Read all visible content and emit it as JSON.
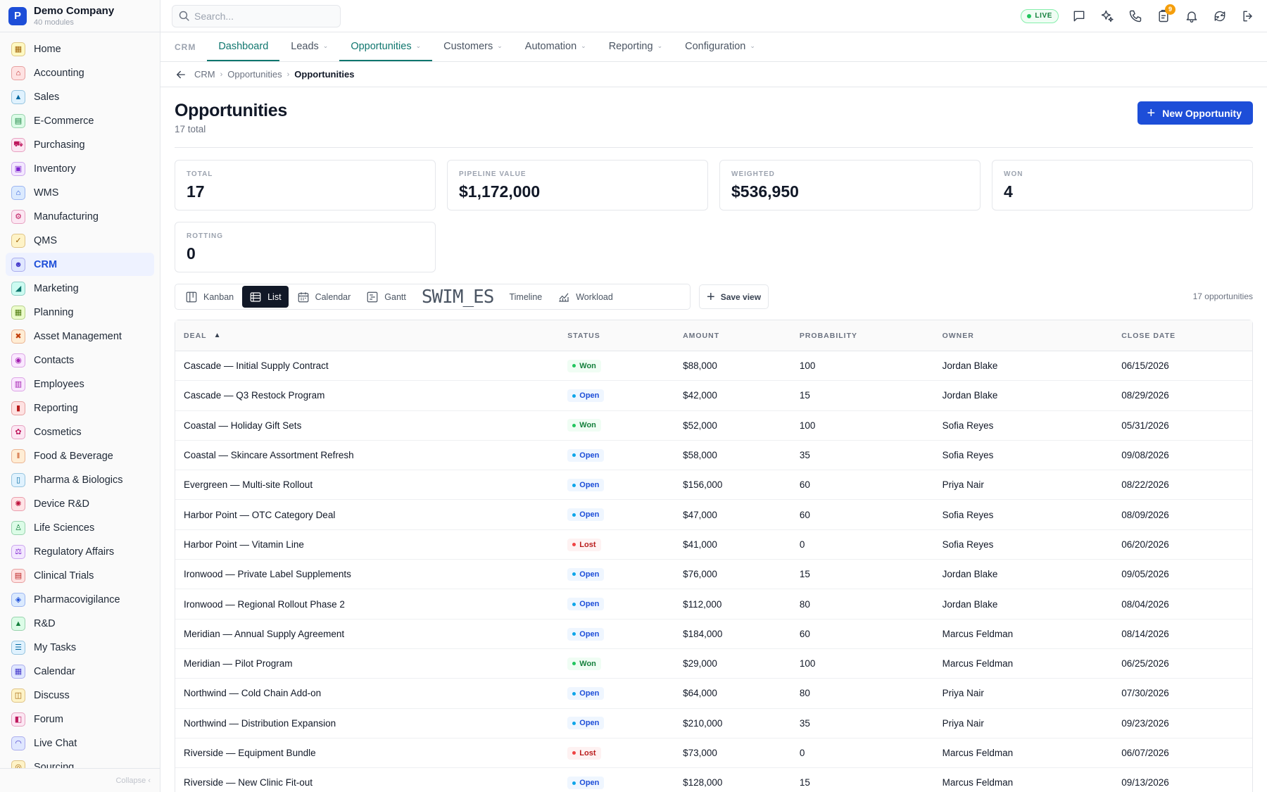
{
  "brand": {
    "logo_letter": "P",
    "name": "Demo Company",
    "subtitle": "40 modules"
  },
  "sidebar": {
    "items": [
      {
        "label": "Home",
        "icon": "grid-icon",
        "glyph": "▦",
        "color": "#a16207",
        "bg": "#fef9c3"
      },
      {
        "label": "Accounting",
        "icon": "bank-icon",
        "glyph": "⌂",
        "color": "#b91c1c",
        "bg": "#fee2e2"
      },
      {
        "label": "Sales",
        "icon": "flask-icon",
        "glyph": "▲",
        "color": "#0369a1",
        "bg": "#e0f2fe"
      },
      {
        "label": "E-Commerce",
        "icon": "store-icon",
        "glyph": "▤",
        "color": "#15803d",
        "bg": "#dcfce7"
      },
      {
        "label": "Purchasing",
        "icon": "cart-icon",
        "glyph": "⛟",
        "color": "#be185d",
        "bg": "#fce7f3"
      },
      {
        "label": "Inventory",
        "icon": "archive-icon",
        "glyph": "▣",
        "color": "#7e22ce",
        "bg": "#f3e8ff"
      },
      {
        "label": "WMS",
        "icon": "warehouse-icon",
        "glyph": "⌂",
        "color": "#1d4ed8",
        "bg": "#dbeafe"
      },
      {
        "label": "Manufacturing",
        "icon": "factory-icon",
        "glyph": "⚙",
        "color": "#be185d",
        "bg": "#fce7f3"
      },
      {
        "label": "QMS",
        "icon": "check-badge-icon",
        "glyph": "✓",
        "color": "#a16207",
        "bg": "#fef3c7"
      },
      {
        "label": "CRM",
        "icon": "users-icon",
        "glyph": "☻",
        "color": "#4338ca",
        "bg": "#e0e7ff"
      },
      {
        "label": "Marketing",
        "icon": "megaphone-icon",
        "glyph": "◢",
        "color": "#0f766e",
        "bg": "#ccfbf1"
      },
      {
        "label": "Planning",
        "icon": "calendar-icon",
        "glyph": "▦",
        "color": "#4d7c0f",
        "bg": "#ecfccb"
      },
      {
        "label": "Asset Management",
        "icon": "tools-icon",
        "glyph": "✖",
        "color": "#c2410c",
        "bg": "#ffedd5"
      },
      {
        "label": "Contacts",
        "icon": "contact-icon",
        "glyph": "◉",
        "color": "#a21caf",
        "bg": "#fae8ff"
      },
      {
        "label": "Employees",
        "icon": "briefcase-icon",
        "glyph": "▥",
        "color": "#a21caf",
        "bg": "#fae8ff"
      },
      {
        "label": "Reporting",
        "icon": "bar-chart-icon",
        "glyph": "▮",
        "color": "#b91c1c",
        "bg": "#fee2e2"
      },
      {
        "label": "Cosmetics",
        "icon": "lotus-icon",
        "glyph": "✿",
        "color": "#be185d",
        "bg": "#fce7f3"
      },
      {
        "label": "Food & Beverage",
        "icon": "utensils-icon",
        "glyph": "‖",
        "color": "#c2410c",
        "bg": "#ffedd5"
      },
      {
        "label": "Pharma & Biologics",
        "icon": "pill-bottle-icon",
        "glyph": "▯",
        "color": "#0369a1",
        "bg": "#e0f2fe"
      },
      {
        "label": "Device R&D",
        "icon": "chip-icon",
        "glyph": "✺",
        "color": "#be123c",
        "bg": "#ffe4e6"
      },
      {
        "label": "Life Sciences",
        "icon": "microscope-icon",
        "glyph": "♙",
        "color": "#15803d",
        "bg": "#dcfce7"
      },
      {
        "label": "Regulatory Affairs",
        "icon": "gavel-icon",
        "glyph": "⚖",
        "color": "#7e22ce",
        "bg": "#f3e8ff"
      },
      {
        "label": "Clinical Trials",
        "icon": "clipboard-icon",
        "glyph": "▤",
        "color": "#b91c1c",
        "bg": "#fee2e2"
      },
      {
        "label": "Pharmacovigilance",
        "icon": "shield-icon",
        "glyph": "◈",
        "color": "#1d4ed8",
        "bg": "#dbeafe"
      },
      {
        "label": "R&D",
        "icon": "beaker-icon",
        "glyph": "▲",
        "color": "#15803d",
        "bg": "#dcfce7"
      },
      {
        "label": "My Tasks",
        "icon": "checklist-icon",
        "glyph": "☰",
        "color": "#0369a1",
        "bg": "#e0f2fe"
      },
      {
        "label": "Calendar",
        "icon": "calendar-icon",
        "glyph": "▦",
        "color": "#4338ca",
        "bg": "#e0e7ff"
      },
      {
        "label": "Discuss",
        "icon": "chat-icon",
        "glyph": "◫",
        "color": "#a16207",
        "bg": "#fef3c7"
      },
      {
        "label": "Forum",
        "icon": "forum-icon",
        "glyph": "◧",
        "color": "#be185d",
        "bg": "#fce7f3"
      },
      {
        "label": "Live Chat",
        "icon": "headset-icon",
        "glyph": "◠",
        "color": "#4338ca",
        "bg": "#e0e7ff"
      },
      {
        "label": "Sourcing",
        "icon": "globe-icon",
        "glyph": "◎",
        "color": "#a16207",
        "bg": "#fef3c7"
      }
    ],
    "active_index": 9,
    "collapse_label": "Collapse ‹"
  },
  "topbar": {
    "search_placeholder": "Search...",
    "live_label": "LIVE",
    "notification_count": "9"
  },
  "tabs": {
    "module": "CRM",
    "items": [
      {
        "label": "Dashboard",
        "active": true,
        "dropdown": false
      },
      {
        "label": "Leads",
        "active": false,
        "dropdown": true
      },
      {
        "label": "Opportunities",
        "active": true,
        "dropdown": true
      },
      {
        "label": "Customers",
        "active": false,
        "dropdown": true
      },
      {
        "label": "Automation",
        "active": false,
        "dropdown": true
      },
      {
        "label": "Reporting",
        "active": false,
        "dropdown": true
      },
      {
        "label": "Configuration",
        "active": false,
        "dropdown": true
      }
    ]
  },
  "breadcrumb": [
    "CRM",
    "Opportunities",
    "Opportunities"
  ],
  "page": {
    "title": "Opportunities",
    "subtitle": "17 total",
    "new_button": "New Opportunity"
  },
  "kpis": [
    {
      "label": "TOTAL",
      "value": "17"
    },
    {
      "label": "PIPELINE VALUE",
      "value": "$1,172,000"
    },
    {
      "label": "WEIGHTED",
      "value": "$536,950"
    },
    {
      "label": "WON",
      "value": "4"
    },
    {
      "label": "ROTTING",
      "value": "0"
    }
  ],
  "views": {
    "items": [
      "Kanban",
      "List",
      "Calendar",
      "Gantt",
      "SWIM_ES",
      "Timeline",
      "Workload"
    ],
    "active": "List",
    "save_label": "Save view",
    "count_label": "17 opportunities"
  },
  "table": {
    "columns": [
      "DEAL",
      "STATUS",
      "AMOUNT",
      "PROBABILITY",
      "OWNER",
      "CLOSE DATE"
    ],
    "rows": [
      {
        "deal": "Cascade — Initial Supply Contract",
        "status": "Won",
        "amount": "$88,000",
        "probability": "100",
        "owner": "Jordan Blake",
        "close": "06/15/2026"
      },
      {
        "deal": "Cascade — Q3 Restock Program",
        "status": "Open",
        "amount": "$42,000",
        "probability": "15",
        "owner": "Jordan Blake",
        "close": "08/29/2026"
      },
      {
        "deal": "Coastal — Holiday Gift Sets",
        "status": "Won",
        "amount": "$52,000",
        "probability": "100",
        "owner": "Sofia Reyes",
        "close": "05/31/2026"
      },
      {
        "deal": "Coastal — Skincare Assortment Refresh",
        "status": "Open",
        "amount": "$58,000",
        "probability": "35",
        "owner": "Sofia Reyes",
        "close": "09/08/2026"
      },
      {
        "deal": "Evergreen — Multi-site Rollout",
        "status": "Open",
        "amount": "$156,000",
        "probability": "60",
        "owner": "Priya Nair",
        "close": "08/22/2026"
      },
      {
        "deal": "Harbor Point — OTC Category Deal",
        "status": "Open",
        "amount": "$47,000",
        "probability": "60",
        "owner": "Sofia Reyes",
        "close": "08/09/2026"
      },
      {
        "deal": "Harbor Point — Vitamin Line",
        "status": "Lost",
        "amount": "$41,000",
        "probability": "0",
        "owner": "Sofia Reyes",
        "close": "06/20/2026"
      },
      {
        "deal": "Ironwood — Private Label Supplements",
        "status": "Open",
        "amount": "$76,000",
        "probability": "15",
        "owner": "Jordan Blake",
        "close": "09/05/2026"
      },
      {
        "deal": "Ironwood — Regional Rollout Phase 2",
        "status": "Open",
        "amount": "$112,000",
        "probability": "80",
        "owner": "Jordan Blake",
        "close": "08/04/2026"
      },
      {
        "deal": "Meridian — Annual Supply Agreement",
        "status": "Open",
        "amount": "$184,000",
        "probability": "60",
        "owner": "Marcus Feldman",
        "close": "08/14/2026"
      },
      {
        "deal": "Meridian — Pilot Program",
        "status": "Won",
        "amount": "$29,000",
        "probability": "100",
        "owner": "Marcus Feldman",
        "close": "06/25/2026"
      },
      {
        "deal": "Northwind — Cold Chain Add-on",
        "status": "Open",
        "amount": "$64,000",
        "probability": "80",
        "owner": "Priya Nair",
        "close": "07/30/2026"
      },
      {
        "deal": "Northwind — Distribution Expansion",
        "status": "Open",
        "amount": "$210,000",
        "probability": "35",
        "owner": "Priya Nair",
        "close": "09/23/2026"
      },
      {
        "deal": "Riverside — Equipment Bundle",
        "status": "Lost",
        "amount": "$73,000",
        "probability": "0",
        "owner": "Marcus Feldman",
        "close": "06/07/2026"
      },
      {
        "deal": "Riverside — New Clinic Fit-out",
        "status": "Open",
        "amount": "$128,000",
        "probability": "15",
        "owner": "Marcus Feldman",
        "close": "09/13/2026"
      }
    ]
  },
  "colors": {
    "accent": "#1d4ed8",
    "tab_active": "#0f766e",
    "won": "#15803d",
    "open": "#1d4ed8",
    "lost": "#b91c1c"
  }
}
